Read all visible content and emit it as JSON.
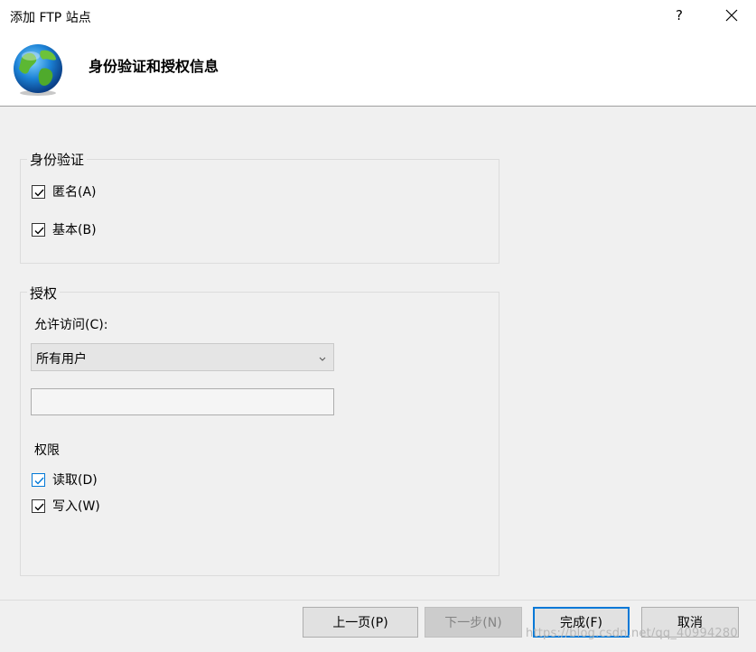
{
  "window": {
    "title": "添加 FTP 站点",
    "help_glyph": "?",
    "close_icon": "close-icon"
  },
  "header": {
    "title": "身份验证和授权信息",
    "icon": "globe-icon"
  },
  "authentication": {
    "legend": "身份验证",
    "anonymous": {
      "label": "匿名(A)",
      "checked": true
    },
    "basic": {
      "label": "基本(B)",
      "checked": true
    }
  },
  "authorization": {
    "legend": "授权",
    "allow_access_label": "允许访问(C):",
    "allow_access_value": "所有用户",
    "user_textbox_value": "",
    "permissions_label": "权限",
    "read": {
      "label": "读取(D)",
      "checked": true
    },
    "write": {
      "label": "写入(W)",
      "checked": true
    }
  },
  "buttons": {
    "previous": "上一页(P)",
    "next": "下一步(N)",
    "finish": "完成(F)",
    "cancel": "取消"
  },
  "watermark": "https://blog.csdn.net/qq_40994280",
  "colors": {
    "accent": "#0078d7",
    "dialog_bg": "#f0f0f0",
    "disabled_text": "#838383"
  }
}
